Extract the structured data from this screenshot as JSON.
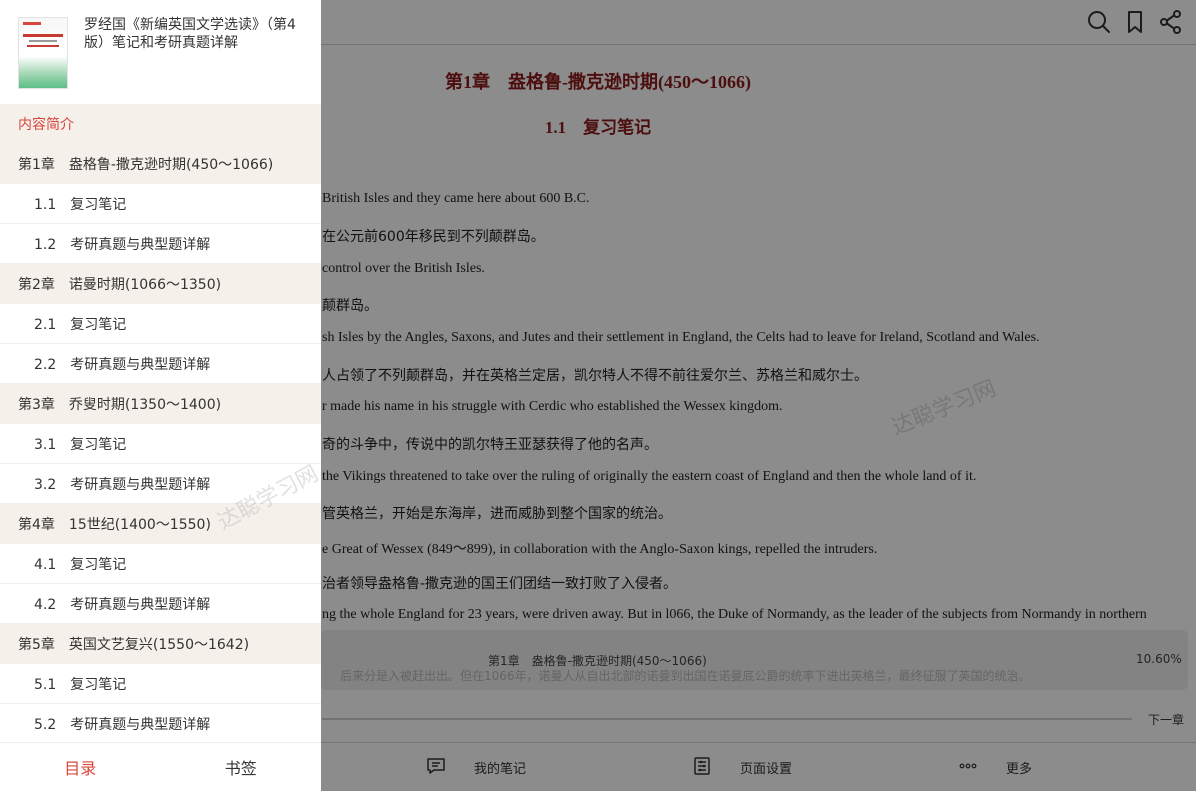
{
  "toc_panel": {
    "book_title": "罗经国《新编英国文学选读》（第4版）笔记和考研真题详解",
    "items": [
      {
        "label": "内容简介",
        "kind": "intro"
      },
      {
        "label": "第1章　盎格鲁-撒克逊时期(450～1066)",
        "kind": "chapter"
      },
      {
        "label": "1.1　复习笔记",
        "kind": "section"
      },
      {
        "label": "1.2　考研真题与典型题详解",
        "kind": "section"
      },
      {
        "label": "第2章　诺曼时期(1066～1350)",
        "kind": "chapter"
      },
      {
        "label": "2.1　复习笔记",
        "kind": "section"
      },
      {
        "label": "2.2　考研真题与典型题详解",
        "kind": "section"
      },
      {
        "label": "第3章　乔叟时期(1350～1400)",
        "kind": "chapter"
      },
      {
        "label": "3.1　复习笔记",
        "kind": "section"
      },
      {
        "label": "3.2　考研真题与典型题详解",
        "kind": "section"
      },
      {
        "label": "第4章　15世纪(1400～1550)",
        "kind": "chapter"
      },
      {
        "label": "4.1　复习笔记",
        "kind": "section"
      },
      {
        "label": "4.2　考研真题与典型题详解",
        "kind": "section"
      },
      {
        "label": "第5章　英国文艺复兴(1550～1642)",
        "kind": "chapter"
      },
      {
        "label": "5.1　复习笔记",
        "kind": "section"
      },
      {
        "label": "5.2　考研真题与典型题详解",
        "kind": "section"
      }
    ],
    "watermark": "达聪学习网",
    "tabs": {
      "contents": "目录",
      "bookmarks": "书签"
    },
    "accent_color": "#d8453b"
  },
  "reader": {
    "chapter_title": "第1章　盎格鲁-撒克逊时期(450～1066)",
    "section_title": "1.1　复习笔记",
    "paragraphs": [
      {
        "text": "British Isles and they came here about 600 B.C.",
        "lang": "en"
      },
      {
        "text": "在公元前600年移民到不列颠群岛。",
        "lang": "cn"
      },
      {
        "text": "control over the British Isles.",
        "lang": "en"
      },
      {
        "text": "颠群岛。",
        "lang": "cn"
      },
      {
        "text": "sh Isles by the Angles, Saxons, and Jutes and their settlement in England, the Celts had to leave for Ireland, Scotland and Wales.",
        "lang": "en"
      },
      {
        "text": "人占领了不列颠群岛，并在英格兰定居，凯尔特人不得不前往爱尔兰、苏格兰和威尔士。",
        "lang": "cn"
      },
      {
        "text": "r made his name in his struggle with Cerdic who established the Wessex kingdom.",
        "lang": "en"
      },
      {
        "text": "奇的斗争中，传说中的凯尔特王亚瑟获得了他的名声。",
        "lang": "cn"
      },
      {
        "text": "the Vikings threatened to take over the ruling of originally the eastern coast of England and then the whole land of it.",
        "lang": "en"
      },
      {
        "text": "管英格兰，开始是东海岸，进而威胁到整个国家的统治。",
        "lang": "cn"
      },
      {
        "text": "e Great of Wessex (849～899), in collaboration with the Anglo-Saxon kings, repelled the intruders.",
        "lang": "en"
      },
      {
        "text": "治者领导盎格鲁-撒克逊的国王们团结一致打败了入侵者。",
        "lang": "cn"
      },
      {
        "text": "ng the whole England for 23 years, were driven away. But in l066, the Duke of Normandy, as the leader of the subjects from Normandy in northern",
        "lang": "en"
      }
    ],
    "watermark": "达聪学习网",
    "progress": {
      "chapter": "第1章　盎格鲁-撒克逊时期(450～1066)",
      "percent": "10.60%",
      "faded_text": "后来分是入被赶出出。但在1066年，诺曼人从自出北部的诺曼到出国在诺曼底公爵的统率下进出英格兰，最终征服了英国的统治。",
      "next_label": "下一章"
    },
    "bottom_bar": {
      "notes_label": "我的笔记",
      "page_settings_label": "页面设置",
      "more_label": "更多"
    }
  }
}
